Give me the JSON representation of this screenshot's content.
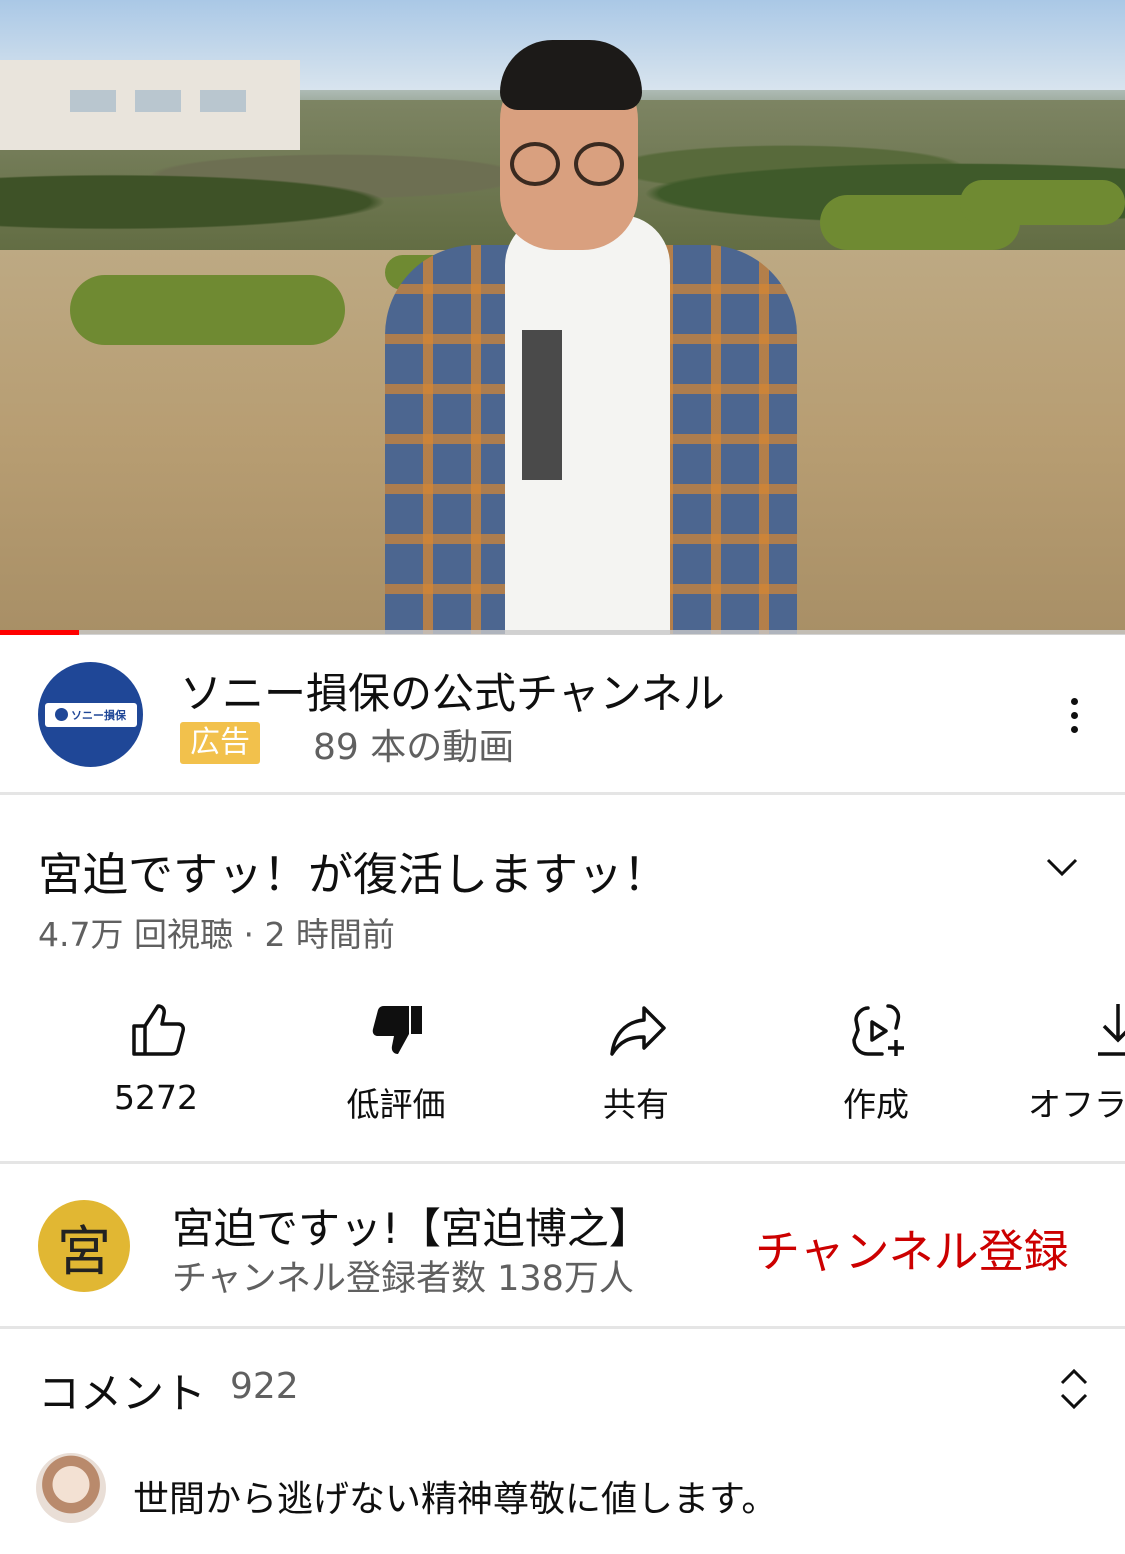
{
  "video": {
    "progress_fraction": 0.07
  },
  "ad": {
    "channel_name": "ソニー損保の公式チャンネル",
    "logo_text": "ソニー損保",
    "badge": "広告",
    "video_count": "89 本の動画"
  },
  "video_info": {
    "title": "宮迫ですッ！が復活しますッ！",
    "meta": "4.7万 回視聴 · 2 時間前"
  },
  "actions": {
    "like_count": "5272",
    "dislike_label": "低評価",
    "share_label": "共有",
    "create_label": "作成",
    "offline_label": "オフラ"
  },
  "channel": {
    "avatar_char": "宮",
    "name": "宮迫ですッ!【宮迫博之】",
    "subscribers": "チャンネル登録者数 138万人",
    "subscribe_label": "チャンネル登録"
  },
  "comments": {
    "label": "コメント",
    "count": "922",
    "top_comment": "世間から逃げない精神尊敬に値します。"
  },
  "colors": {
    "subscribe": "#cc0000",
    "ad_badge": "#f2c14c",
    "progress": "#ff0000"
  }
}
